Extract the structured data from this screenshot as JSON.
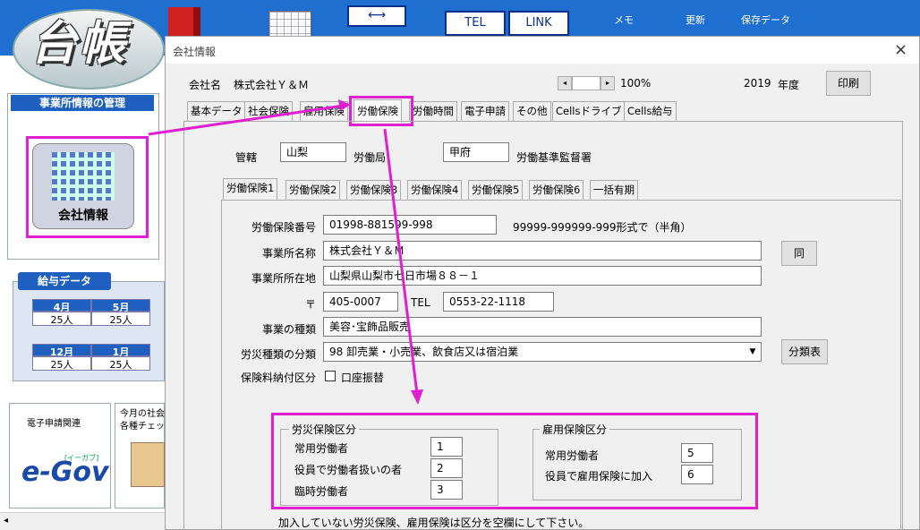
{
  "app": {
    "logo_text": "台帳"
  },
  "toolbar": {
    "tel_label": "TEL",
    "link_label": "LINK",
    "memo_label": "メモ",
    "update_label": "更新",
    "save_label": "保存データ"
  },
  "left_panel": {
    "office_header": "事業所情報の管理",
    "company_info_label": "会社情報",
    "salary_header": "給与データ",
    "months_row1": [
      "4月",
      "5月"
    ],
    "counts_row1": [
      "25人",
      "25人"
    ],
    "months_row2": [
      "12月",
      "1月"
    ],
    "counts_row2": [
      "25人",
      "25人"
    ],
    "egov_caption": "電子申請関連",
    "egov_logo": "e-Gov",
    "egov_kana": "[イーガブ]",
    "monthly_caption": "今月の社会\n各種チェッ"
  },
  "dialog": {
    "title": "会社情報",
    "close": "×",
    "company_label": "会社名",
    "company_name": "株式会社Ｙ＆Ｍ",
    "zoom": "100%",
    "year": "2019",
    "year_label": "年度",
    "print_button": "印刷",
    "tabs": [
      "基本データ",
      "社会保険",
      "雇用保険",
      "労働保険",
      "労働時間",
      "電子申請",
      "その他",
      "Cellsドライブ",
      "Cells給与"
    ],
    "jurisdiction_label": "管轄",
    "jurisdiction_value": "山梨",
    "labor_bureau_label": "労働局",
    "inspection_value": "甲府",
    "inspection_label": "労働基準監督署",
    "subtabs": [
      "労働保険1",
      "労働保険2",
      "労働保険3",
      "労働保険4",
      "労働保険5",
      "労働保険6",
      "一括有期"
    ],
    "fields": {
      "insurance_no_label": "労働保険番号",
      "insurance_no_value": "01998-881599-998",
      "insurance_no_hint": "99999-999999-999形式で（半角）",
      "office_name_label": "事業所名称",
      "office_name_value": "株式会社Ｙ＆Ｍ",
      "same_button": "同",
      "address_label": "事業所所在地",
      "address_value": "山梨県山梨市七日市場８８－１",
      "zip_label": "〒",
      "zip_value": "405-0007",
      "tel_label": "TEL",
      "tel_value": "0553-22-1118",
      "business_type_label": "事業の種類",
      "business_type_value": "美容･宝飾品販売",
      "accident_class_label": "労災種類の分類",
      "accident_class_value": "98 卸売業・小売業、飲食店又は宿泊業",
      "class_table_button": "分類表",
      "payment_label": "保険料納付区分",
      "account_transfer_label": "口座振替"
    },
    "rousai_group": {
      "title": "労災保険区分",
      "rows": [
        {
          "label": "常用労働者",
          "value": "1"
        },
        {
          "label": "役員で労働者扱いの者",
          "value": "2"
        },
        {
          "label": "臨時労働者",
          "value": "3"
        }
      ]
    },
    "koyou_group": {
      "title": "雇用保険区分",
      "rows": [
        {
          "label": "常用労働者",
          "value": "5"
        },
        {
          "label": "役員で雇用保険に加入",
          "value": "6"
        }
      ]
    },
    "footer_note": "加入していない労災保険、雇用保険は区分を空欄にして下さい。"
  },
  "colors": {
    "accent": "#e020d0",
    "banner": "#1f6fd0",
    "header": "#1f5fbf"
  }
}
